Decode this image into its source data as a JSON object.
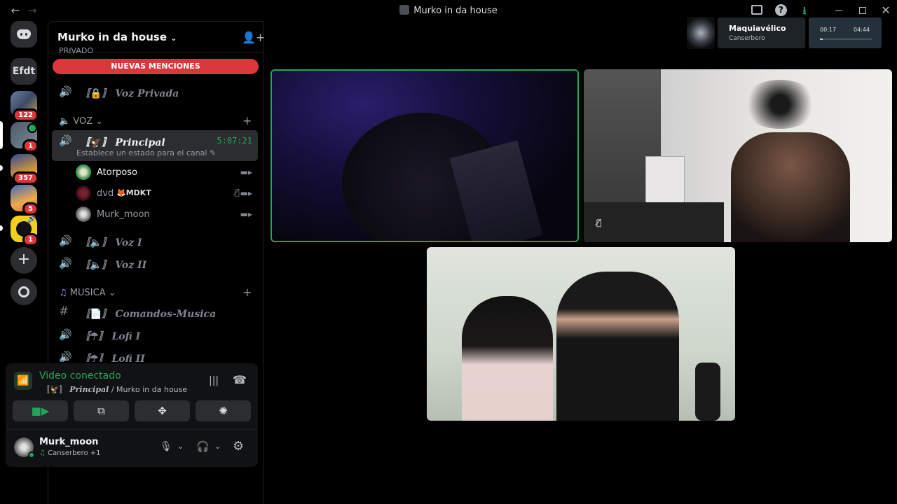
{
  "window": {
    "title": "Murko in da house",
    "back_icon": "arrow-left-icon",
    "forward_icon": "arrow-right-icon",
    "buttons": [
      "inbox-icon",
      "help-icon",
      "download-icon",
      "minimize-icon",
      "maximize-icon",
      "close-icon"
    ]
  },
  "rail": {
    "servers": [
      {
        "name": "discord-home",
        "badge": ""
      },
      {
        "name": "Efdt",
        "label": "Efdt",
        "badge": ""
      },
      {
        "name": "server-1",
        "badge": "122"
      },
      {
        "name": "server-2",
        "badge": "1"
      },
      {
        "name": "server-3",
        "badge": "357"
      },
      {
        "name": "server-4",
        "badge": "5"
      },
      {
        "name": "server-5",
        "badge": "1"
      }
    ],
    "add_server_icon": "plus-icon",
    "discover_icon": "compass-icon"
  },
  "sidebar": {
    "guild_name": "Murko in da house",
    "new_mentions": "NUEVAS MENCIONES",
    "private_category": "PRIVADO",
    "private_channel": "Voz Privada",
    "voice_category": "VOZ",
    "principal": {
      "name": "Principal",
      "timer": "5:07:21",
      "status": "Establece un estado para el canal"
    },
    "users": [
      {
        "name": "Atorposo",
        "tag": ""
      },
      {
        "name": "dvd",
        "tag": "MDKT"
      },
      {
        "name": "Murk_moon",
        "tag": ""
      }
    ],
    "voice_channels": [
      "Voz I",
      "Voz II"
    ],
    "music_category": "MUSICA",
    "music_channels": [
      {
        "name": "Comandos-Musica",
        "type": "text"
      },
      {
        "name": "Lofi I",
        "type": "voice"
      },
      {
        "name": "Lofi II",
        "type": "voice"
      }
    ]
  },
  "voice_panel": {
    "status": "Video conectado",
    "channel": "Principal",
    "separator": "/",
    "guild": "Murko in da house"
  },
  "user_panel": {
    "username": "Murk_moon",
    "activity": "Canserbero +1"
  },
  "now_playing": {
    "title": "Maquiavélico",
    "artist": "Canserbero",
    "elapsed": "00:17",
    "duration": "04:44",
    "progress": 0.06
  },
  "colors": {
    "accent_green": "#23a559",
    "mention_red": "#da373c",
    "timer_green": "#23a559"
  }
}
